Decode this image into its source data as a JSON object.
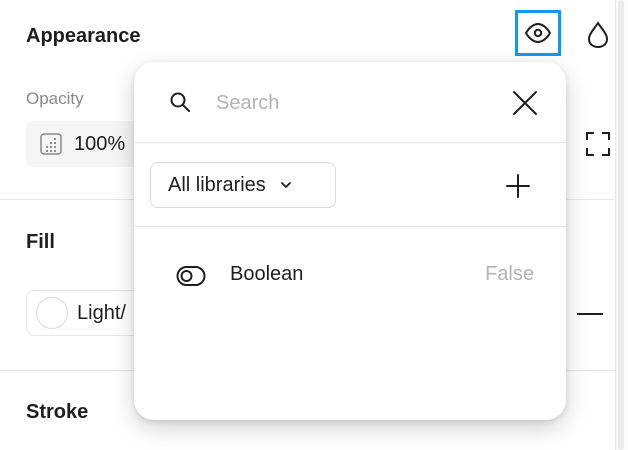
{
  "panel": {
    "appearance": {
      "title": "Appearance",
      "visibility_icon": "eye-icon",
      "blend_icon": "drop-icon",
      "opacity_label": "Opacity",
      "opacity_value": "100%",
      "expand_icon": "corners-icon"
    },
    "fill": {
      "title": "Fill",
      "swatch_name": "Light/",
      "remove_icon": "minus-icon"
    },
    "stroke": {
      "title": "Stroke"
    }
  },
  "popup": {
    "search": {
      "placeholder": "Search",
      "value": ""
    },
    "library_select": {
      "selected": "All libraries"
    },
    "add_icon": "plus-icon",
    "close_icon": "close-icon",
    "variables": [
      {
        "name": "Boolean",
        "value": "False",
        "icon": "boolean-toggle-icon"
      }
    ]
  },
  "colors": {
    "accent": "#0d99ff",
    "muted_text": "#8a8a8a",
    "placeholder_text": "#b3b3b3",
    "field_bg": "#f5f5f5",
    "border": "#e6e6e6"
  }
}
